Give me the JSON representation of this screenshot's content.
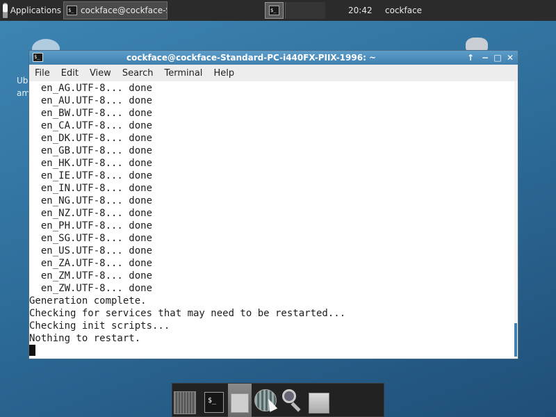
{
  "top_panel": {
    "applications_label": "Applications",
    "task_label": "cockface@cockface-Stand...",
    "clock": "20:42",
    "user": "cockface"
  },
  "desktop": {
    "text_line1": "Ub",
    "text_line2": "am"
  },
  "window": {
    "title": "cockface@cockface-Standard-PC-i440FX-PIIX-1996: ~",
    "controls": {
      "shade": "↑",
      "minimize": "−",
      "maximize": "□",
      "close": "✕"
    }
  },
  "menu": [
    "File",
    "Edit",
    "View",
    "Search",
    "Terminal",
    "Help"
  ],
  "terminal": {
    "lines": [
      "  en_AG.UTF-8... done",
      "  en_AU.UTF-8... done",
      "  en_BW.UTF-8... done",
      "  en_CA.UTF-8... done",
      "  en_DK.UTF-8... done",
      "  en_GB.UTF-8... done",
      "  en_HK.UTF-8... done",
      "  en_IE.UTF-8... done",
      "  en_IN.UTF-8... done",
      "  en_NG.UTF-8... done",
      "  en_NZ.UTF-8... done",
      "  en_PH.UTF-8... done",
      "  en_SG.UTF-8... done",
      "  en_US.UTF-8... done",
      "  en_ZA.UTF-8... done",
      "  en_ZM.UTF-8... done",
      "  en_ZW.UTF-8... done",
      "Generation complete.",
      "Checking for services that may need to be restarted...",
      "Checking init scripts...",
      "Nothing to restart."
    ],
    "prompt": ""
  },
  "dock": {
    "terminal_glyph": "$_"
  },
  "colors": {
    "title_bar": "#4f90c0",
    "panel": "#2b2b2b",
    "desktop": "#2f6f9c"
  }
}
